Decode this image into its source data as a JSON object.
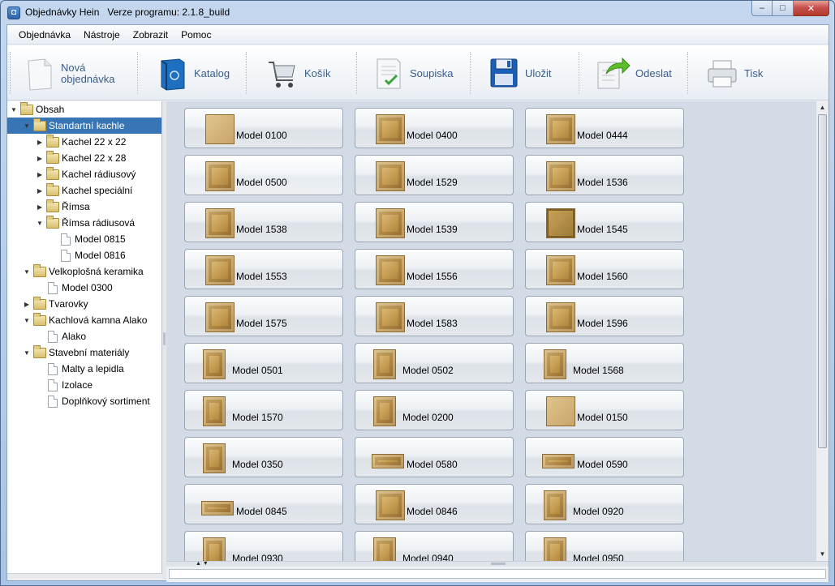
{
  "window": {
    "title": "Objednávky Hein   Verze programu: 2.1.8_build",
    "app_icon": "app-icon",
    "controls": {
      "minimize": "–",
      "maximize": "□",
      "close": "✕"
    }
  },
  "menu": [
    {
      "label": "Objednávka",
      "name": "menu-objednavka"
    },
    {
      "label": "Nástroje",
      "name": "menu-nastroje"
    },
    {
      "label": "Zobrazit",
      "name": "menu-zobrazit"
    },
    {
      "label": "Pomoc",
      "name": "menu-pomoc"
    }
  ],
  "toolbar": {
    "new_order": {
      "label_line1": "Nová",
      "label_line2": "objednávka",
      "icon": "new-document-icon"
    },
    "catalog": {
      "label": "Katalog",
      "icon": "catalog-book-icon"
    },
    "cart": {
      "label": "Košík",
      "icon": "shopping-cart-icon"
    },
    "summary": {
      "label": "Soupiska",
      "icon": "checklist-icon"
    },
    "save": {
      "label": "Uložit",
      "icon": "floppy-disk-icon"
    },
    "send": {
      "label": "Odeslat",
      "icon": "send-arrow-icon"
    },
    "print": {
      "label": "Tisk",
      "icon": "printer-icon"
    }
  },
  "tree": [
    {
      "label": "Obsah",
      "type": "folder",
      "expanded": true
    },
    {
      "label": "Standartní kachle",
      "type": "folder",
      "expanded": true,
      "selected": true
    },
    {
      "label": "Kachel 22 x 22",
      "type": "folder",
      "expanded": false
    },
    {
      "label": "Kachel 22 x 28",
      "type": "folder",
      "expanded": false
    },
    {
      "label": "Kachel rádiusový",
      "type": "folder",
      "expanded": false
    },
    {
      "label": "Kachel speciální",
      "type": "folder",
      "expanded": false
    },
    {
      "label": "Římsa",
      "type": "folder",
      "expanded": false
    },
    {
      "label": "Římsa rádiusová",
      "type": "folder",
      "expanded": true
    },
    {
      "label": "Model 0815",
      "type": "doc"
    },
    {
      "label": "Model 0816",
      "type": "doc"
    },
    {
      "label": "Velkoplošná keramika",
      "type": "folder",
      "expanded": true
    },
    {
      "label": "Model 0300",
      "type": "doc"
    },
    {
      "label": "Tvarovky",
      "type": "folder",
      "expanded": false
    },
    {
      "label": "Kachlová kamna Alako",
      "type": "folder",
      "expanded": true
    },
    {
      "label": "Alako",
      "type": "doc"
    },
    {
      "label": "Stavební materiály",
      "type": "folder",
      "expanded": true
    },
    {
      "label": "Malty a lepidla",
      "type": "doc"
    },
    {
      "label": "Izolace",
      "type": "doc"
    },
    {
      "label": "Doplňkový sortiment",
      "type": "doc"
    }
  ],
  "products": [
    "Model 0100",
    "Model 0400",
    "Model 0444",
    "Model 0500",
    "Model 1529",
    "Model 1536",
    "Model 1538",
    "Model 1539",
    "Model 1545",
    "Model 1553",
    "Model 1556",
    "Model 1560",
    "Model 1575",
    "Model 1583",
    "Model 1596",
    "Model 0501",
    "Model 0502",
    "Model 1568",
    "Model 1570",
    "Model 0200",
    "Model 0150",
    "Model 0350",
    "Model 0580",
    "Model 0590",
    "Model 0845",
    "Model 0846",
    "Model 0920",
    "Model 0930",
    "Model 0940",
    "Model 0950"
  ],
  "colors": {
    "selection": "#3875b5",
    "toolbar_text": "#3a5c8c",
    "tile_thumb": "#c49a50"
  }
}
